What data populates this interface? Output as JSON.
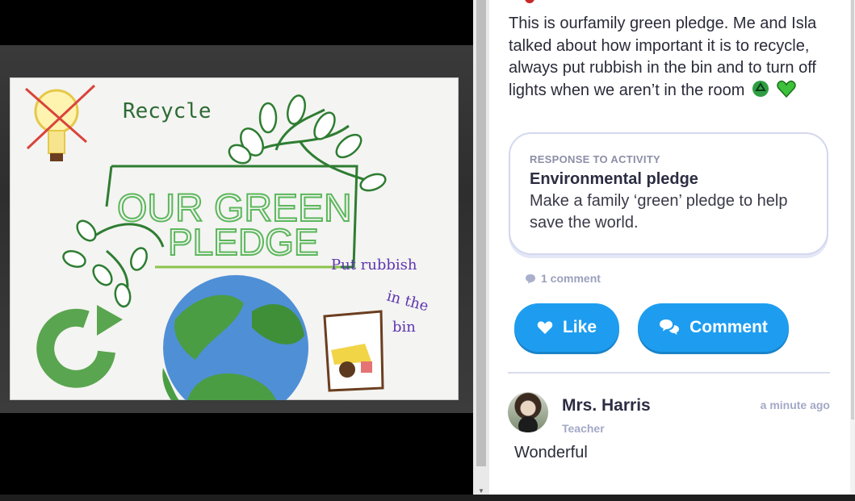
{
  "post": {
    "text": "This is ourfamily green pledge. Me and Isla talked about how important it is to recycle, always put rubbish in the bin and to turn off lights when we aren’t in the room"
  },
  "activity": {
    "kicker": "RESPONSE TO ACTIVITY",
    "title": "Environmental pledge",
    "description": "Make a family ‘green’ pledge to help save the world."
  },
  "comments": {
    "count_label": "1 comment"
  },
  "actions": {
    "like_label": "Like",
    "comment_label": "Comment"
  },
  "comment": {
    "author": "Mrs. Harris",
    "role": "Teacher",
    "time": "a minute ago",
    "text": "Wonderful"
  },
  "photo": {
    "drawing": {
      "recycle_word": "Recycle",
      "pledge_line1": "OUR GREEN",
      "pledge_line2": "PLEDGE",
      "bin_note_1": "Put rubbish",
      "bin_note_2": "in the",
      "bin_note_3": "bin"
    }
  },
  "colors": {
    "accent": "#1e9df0",
    "card_border": "#d3d8ef",
    "muted": "#a3a8c6"
  },
  "icons": [
    "heart-icon",
    "chat-bubbles-icon",
    "comment-bubble-icon",
    "scroll-down-arrow-icon"
  ]
}
